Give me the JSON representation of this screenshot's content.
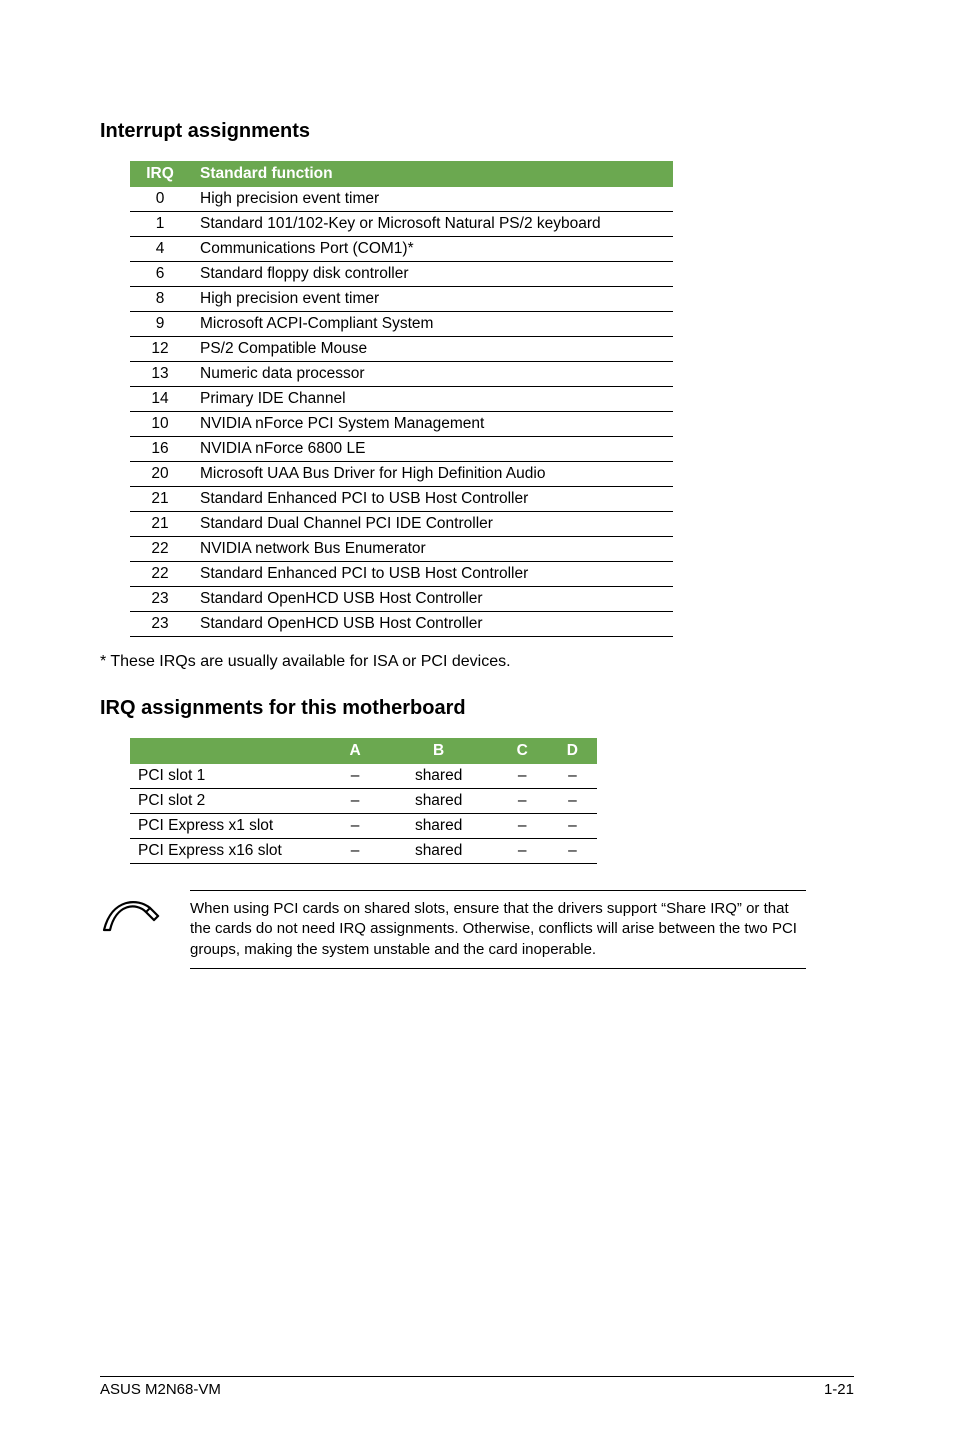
{
  "section1_title": "Interrupt assignments",
  "section2_title": "IRQ assignments for this motherboard",
  "irq_table": {
    "h1": "IRQ",
    "h2": "Standard function",
    "rows": [
      {
        "irq": "0",
        "fn": "High precision event timer"
      },
      {
        "irq": "1",
        "fn": "Standard 101/102-Key or Microsoft Natural PS/2 keyboard"
      },
      {
        "irq": "4",
        "fn": "Communications Port (COM1)*"
      },
      {
        "irq": "6",
        "fn": "Standard floppy disk controller"
      },
      {
        "irq": "8",
        "fn": "High precision event timer"
      },
      {
        "irq": "9",
        "fn": "Microsoft ACPI-Compliant System"
      },
      {
        "irq": "12",
        "fn": "PS/2 Compatible Mouse"
      },
      {
        "irq": "13",
        "fn": "Numeric data processor"
      },
      {
        "irq": "14",
        "fn": "Primary IDE Channel"
      },
      {
        "irq": "10",
        "fn": "NVIDIA nForce PCI System Management"
      },
      {
        "irq": "16",
        "fn": "NVIDIA nForce 6800 LE"
      },
      {
        "irq": "20",
        "fn": "Microsoft UAA Bus Driver for High Definition Audio"
      },
      {
        "irq": "21",
        "fn": "Standard Enhanced PCI to USB Host Controller"
      },
      {
        "irq": "21",
        "fn": "Standard Dual Channel PCI IDE Controller"
      },
      {
        "irq": "22",
        "fn": "NVIDIA network Bus Enumerator"
      },
      {
        "irq": "22",
        "fn": "Standard Enhanced PCI to USB Host Controller"
      },
      {
        "irq": "23",
        "fn": "Standard OpenHCD USB Host Controller"
      },
      {
        "irq": "23",
        "fn": "Standard OpenHCD USB Host Controller"
      }
    ]
  },
  "note_star": "* These IRQs are usually available for ISA or PCI devices.",
  "assign_table": {
    "headers": {
      "a": "A",
      "b": "B",
      "c": "C",
      "d": "D"
    },
    "rows": [
      {
        "label": "PCI slot 1",
        "a": "–",
        "b": "shared",
        "c": "–",
        "d": "–"
      },
      {
        "label": "PCI slot 2",
        "a": "–",
        "b": "shared",
        "c": "–",
        "d": "–"
      },
      {
        "label": "PCI Express x1 slot",
        "a": "–",
        "b": "shared",
        "c": "–",
        "d": "–"
      },
      {
        "label": "PCI Express x16 slot",
        "a": "–",
        "b": "shared",
        "c": "–",
        "d": "–"
      }
    ]
  },
  "callout_text": "When using PCI cards on shared slots, ensure that the drivers support “Share IRQ” or that the cards do not need IRQ assignments. Otherwise, conflicts will arise between the two PCI groups, making the system unstable and the card inoperable.",
  "footer_left": "ASUS M2N68-VM",
  "footer_right": "1-21",
  "icon_name": "note-icon"
}
